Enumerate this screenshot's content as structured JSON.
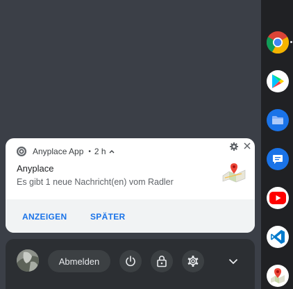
{
  "notification": {
    "app_name": "Anyplace App",
    "separator": "•",
    "time": "2 h",
    "title": "Anyplace",
    "message": "Es gibt 1 neue Nachricht(en) vom Radler",
    "actions": [
      "ANZEIGEN",
      "SPÄTER"
    ]
  },
  "tray": {
    "signout_label": "Abmelden"
  },
  "shelf": {
    "apps": [
      "chrome-icon",
      "play-store-icon",
      "files-icon",
      "messages-icon",
      "youtube-icon",
      "vscode-icon",
      "maps-icon"
    ]
  },
  "colors": {
    "accent": "#1a73e8",
    "background": "#3b3f47",
    "shelf": "#202124",
    "tray": "#2c2f33"
  }
}
